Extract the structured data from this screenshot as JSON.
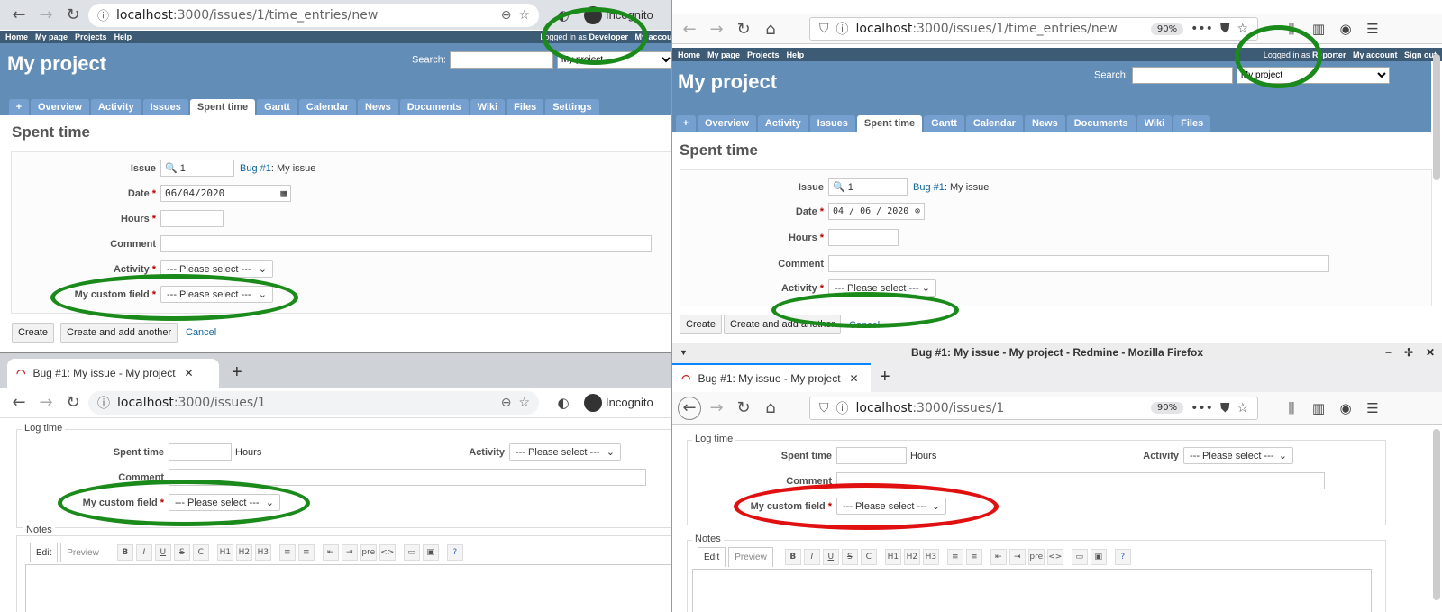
{
  "top_left": {
    "url_host": "localhost",
    "url_path": ":3000/issues/1/time_entries/new",
    "incognito": "Incognito",
    "top_menu": [
      "Home",
      "My page",
      "Projects",
      "Help"
    ],
    "logged_in_prefix": "Logged in as",
    "logged_in_user": "Developer",
    "my_account": "My account",
    "project_title": "My project",
    "search_label": "Search:",
    "project_select": "My project",
    "tabs": [
      "+",
      "Overview",
      "Activity",
      "Issues",
      "Spent time",
      "Gantt",
      "Calendar",
      "News",
      "Documents",
      "Wiki",
      "Files",
      "Settings"
    ],
    "heading": "Spent time",
    "issue_label": "Issue",
    "issue_value": "1",
    "issue_link": "Bug #1",
    "issue_subject": ": My issue",
    "date_label": "Date",
    "date_value": "06/04/2020",
    "hours_label": "Hours",
    "comment_label": "Comment",
    "activity_label": "Activity",
    "activity_value": "--- Please select ---",
    "custom_label": "My custom field",
    "custom_value": "--- Please select ---",
    "create": "Create",
    "create_another": "Create and add another",
    "cancel": "Cancel"
  },
  "top_right": {
    "url_host": "localhost",
    "url_path": ":3000/issues/1/time_entries/new",
    "zoom": "90%",
    "top_menu": [
      "Home",
      "My page",
      "Projects",
      "Help"
    ],
    "logged_in_prefix": "Logged in as",
    "logged_in_user": "Reporter",
    "my_account": "My account",
    "sign_out": "Sign out",
    "project_title": "My project",
    "search_label": "Search:",
    "project_select": "My project",
    "tabs": [
      "+",
      "Overview",
      "Activity",
      "Issues",
      "Spent time",
      "Gantt",
      "Calendar",
      "News",
      "Documents",
      "Wiki",
      "Files"
    ],
    "heading": "Spent time",
    "issue_label": "Issue",
    "issue_value": "1",
    "issue_link": "Bug #1",
    "issue_subject": ": My issue",
    "date_label": "Date",
    "date_value": "04 / 06 / 2020",
    "hours_label": "Hours",
    "comment_label": "Comment",
    "activity_label": "Activity",
    "activity_value": "--- Please select ---",
    "create": "Create",
    "create_another": "Create and add another",
    "cancel": "Cancel"
  },
  "bottom_left": {
    "tab_title": "Bug #1: My issue - My project -",
    "url_host": "localhost",
    "url_path": ":3000/issues/1",
    "incognito": "Incognito",
    "log_time": "Log time",
    "spent_label": "Spent time",
    "hours_suffix": "Hours",
    "activity_label": "Activity",
    "activity_value": "--- Please select ---",
    "comment_label": "Comment",
    "custom_label": "My custom field",
    "custom_value": "--- Please select ---",
    "notes": "Notes",
    "edit": "Edit",
    "preview": "Preview",
    "toolbar": [
      "B",
      "I",
      "U",
      "S",
      "C",
      "H1",
      "H2",
      "H3",
      "≡",
      "≡",
      "⇤",
      "⇥",
      "pre",
      "<>",
      "▭",
      "▣",
      "?"
    ]
  },
  "bottom_right": {
    "window_title": "Bug #1: My issue - My project - Redmine - Mozilla Firefox",
    "tab_title": "Bug #1: My issue - My project",
    "url_host": "localhost",
    "url_path": ":3000/issues/1",
    "zoom": "90%",
    "log_time": "Log time",
    "spent_label": "Spent time",
    "hours_suffix": "Hours",
    "activity_label": "Activity",
    "activity_value": "--- Please select ---",
    "comment_label": "Comment",
    "custom_label": "My custom field",
    "custom_value": "--- Please select ---",
    "notes": "Notes",
    "edit": "Edit",
    "preview": "Preview",
    "toolbar": [
      "B",
      "I",
      "U",
      "S",
      "C",
      "H1",
      "H2",
      "H3",
      "≡",
      "≡",
      "⇤",
      "⇥",
      "pre",
      "<>",
      "▭",
      "▣",
      "?"
    ]
  },
  "colors": {
    "ring_green": "#1a8a1a",
    "ring_red": "#e01010",
    "redmine_header": "#628db6",
    "redmine_top": "#3e5b76"
  }
}
